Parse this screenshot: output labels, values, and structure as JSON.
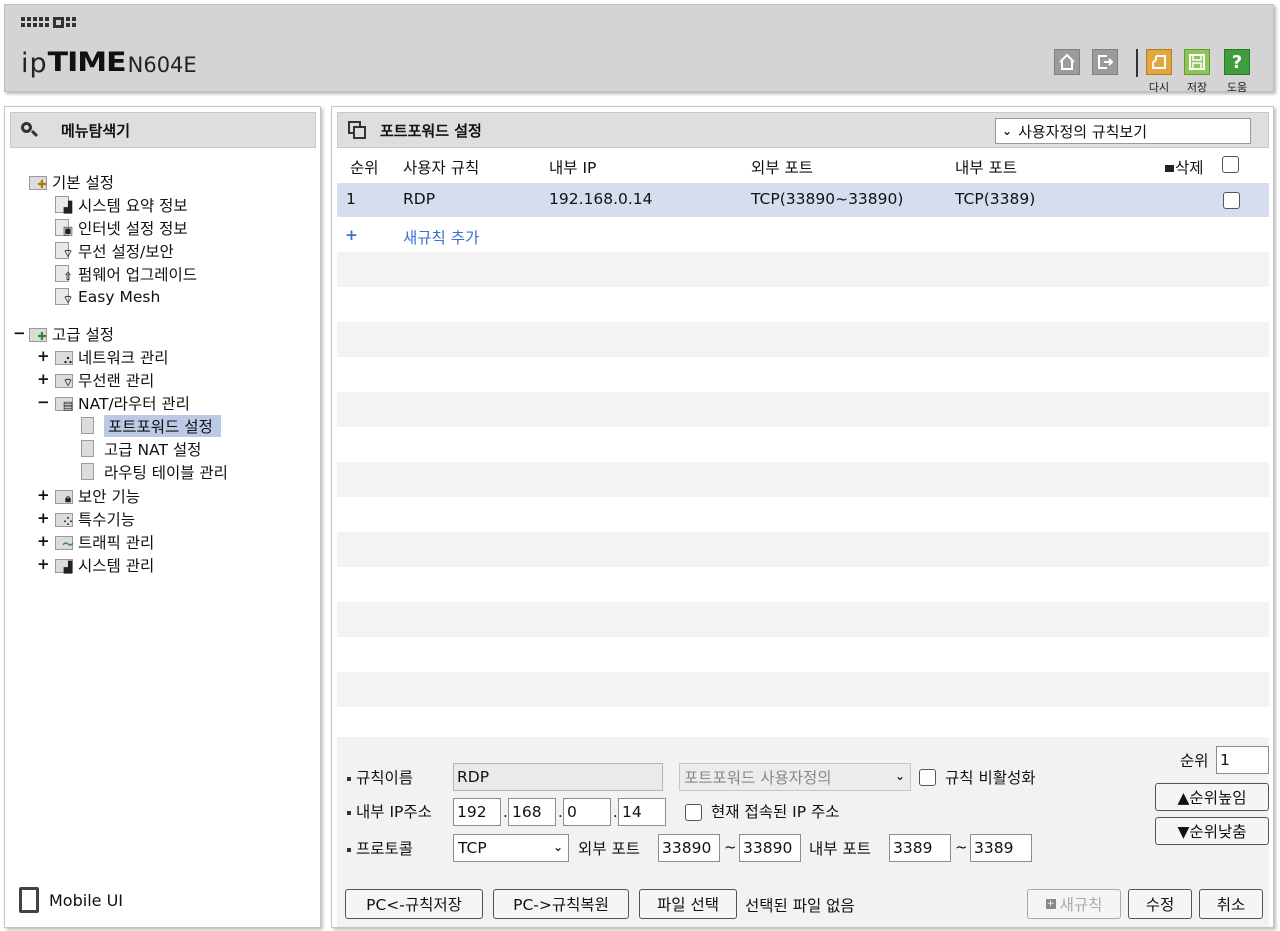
{
  "header": {
    "model": "N604E",
    "buttons": [
      {
        "icon": "home-icon",
        "label": ""
      },
      {
        "icon": "logout-icon",
        "label": ""
      },
      {
        "icon": "reboot-icon",
        "label": "다시",
        "color": "#e3a63e"
      },
      {
        "icon": "save-icon",
        "label": "저장",
        "color": "#8fc45a"
      },
      {
        "icon": "help-icon",
        "label": "도움",
        "color": "#3f9c3f"
      }
    ]
  },
  "sidebar": {
    "title": "메뉴탐색기",
    "basic": {
      "label": "기본 설정",
      "items": [
        "시스템 요약 정보",
        "인터넷 설정 정보",
        "무선 설정/보안",
        "펌웨어 업그레이드",
        "Easy Mesh"
      ]
    },
    "advanced": {
      "label": "고급 설정",
      "items": [
        {
          "label": "네트워크 관리",
          "toggle": "+"
        },
        {
          "label": "무선랜 관리",
          "toggle": "+"
        },
        {
          "label": "NAT/라우터 관리",
          "toggle": "−",
          "children": [
            "포트포워드 설정",
            "고급 NAT 설정",
            "라우팅 테이블 관리"
          ]
        },
        {
          "label": "보안 기능",
          "toggle": "+"
        },
        {
          "label": "특수기능",
          "toggle": "+"
        },
        {
          "label": "트래픽 관리",
          "toggle": "+"
        },
        {
          "label": "시스템 관리",
          "toggle": "+"
        }
      ],
      "toggle": "−"
    },
    "mobile_ui": "Mobile UI"
  },
  "main": {
    "title": "포트포워드 설정",
    "view_select": "사용자정의 규칙보기",
    "columns": {
      "order": "순위",
      "rule": "사용자 규칙",
      "internal_ip": "내부 IP",
      "external_port": "외부 포트",
      "internal_port": "내부 포트",
      "delete": "삭제"
    },
    "rows": [
      {
        "order": "1",
        "rule": "RDP",
        "internal_ip": "192.168.0.14",
        "external_port": "TCP(33890~33890)",
        "internal_port": "TCP(3389)"
      }
    ],
    "add_row": {
      "plus": "+",
      "label": "새규칙 추가"
    }
  },
  "form": {
    "rule_name_label": "규칙이름",
    "rule_name": "RDP",
    "rule_type": "포트포워드 사용자정의",
    "disable_label": "규칙 비활성화",
    "ip_label": "내부 IP주소",
    "ip": [
      "192",
      "168",
      "0",
      "14"
    ],
    "current_ip_label": "현재 접속된 IP 주소",
    "protocol_label": "프로토콜",
    "protocol": "TCP",
    "ext_port_label": "외부 포트",
    "ext_port_from": "33890",
    "ext_port_to": "33890",
    "int_port_label": "내부 포트",
    "int_port_from": "3389",
    "int_port_to": "3389",
    "order_label": "순위",
    "order": "1",
    "order_up": "▲순위높임",
    "order_down": "▼순위낮춤",
    "pc_save": "PC<-규칙저장",
    "pc_restore": "PC->규칙복원",
    "file_select": "파일 선택",
    "file_status": "선택된 파일 없음",
    "new_rule": "새규칙",
    "modify": "수정",
    "cancel": "취소"
  }
}
